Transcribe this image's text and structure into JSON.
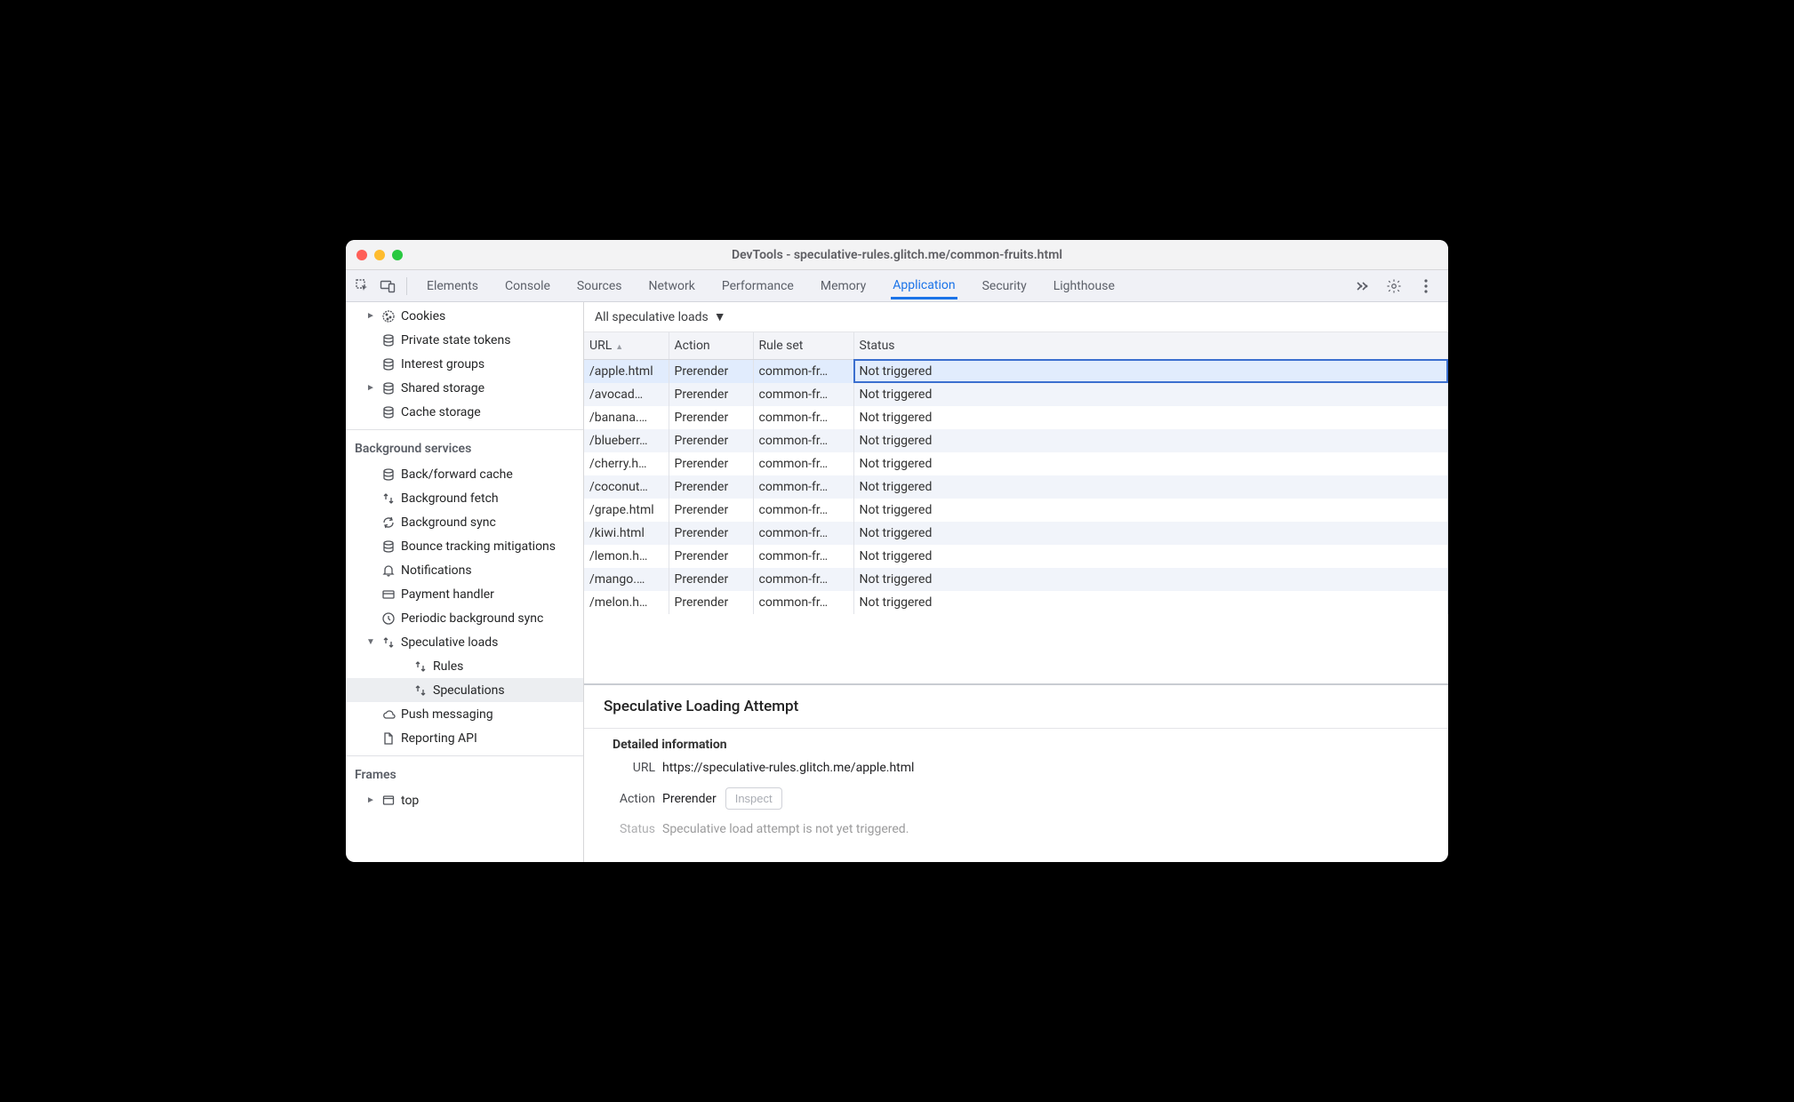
{
  "window": {
    "title": "DevTools - speculative-rules.glitch.me/common-fruits.html"
  },
  "tabs": [
    {
      "label": "Elements",
      "active": false
    },
    {
      "label": "Console",
      "active": false
    },
    {
      "label": "Sources",
      "active": false
    },
    {
      "label": "Network",
      "active": false
    },
    {
      "label": "Performance",
      "active": false
    },
    {
      "label": "Memory",
      "active": false
    },
    {
      "label": "Application",
      "active": true
    },
    {
      "label": "Security",
      "active": false
    },
    {
      "label": "Lighthouse",
      "active": false
    }
  ],
  "sidebar": {
    "storage_items": [
      {
        "label": "Cookies",
        "icon": "cookie",
        "twisty": "►",
        "indent": 1
      },
      {
        "label": "Private state tokens",
        "icon": "database",
        "twisty": "",
        "indent": 1
      },
      {
        "label": "Interest groups",
        "icon": "database",
        "twisty": "",
        "indent": 1
      },
      {
        "label": "Shared storage",
        "icon": "database",
        "twisty": "►",
        "indent": 1
      },
      {
        "label": "Cache storage",
        "icon": "database",
        "twisty": "",
        "indent": 1
      }
    ],
    "bg_heading": "Background services",
    "bg_items": [
      {
        "label": "Back/forward cache",
        "icon": "database",
        "indent": 1
      },
      {
        "label": "Background fetch",
        "icon": "updown",
        "indent": 1
      },
      {
        "label": "Background sync",
        "icon": "sync",
        "indent": 1
      },
      {
        "label": "Bounce tracking mitigations",
        "icon": "database",
        "indent": 1
      },
      {
        "label": "Notifications",
        "icon": "bell",
        "indent": 1
      },
      {
        "label": "Payment handler",
        "icon": "card",
        "indent": 1
      },
      {
        "label": "Periodic background sync",
        "icon": "clock",
        "indent": 1
      },
      {
        "label": "Speculative loads",
        "icon": "updown",
        "indent": 1,
        "twisty": "▼"
      },
      {
        "label": "Rules",
        "icon": "updown",
        "indent": 3
      },
      {
        "label": "Speculations",
        "icon": "updown",
        "indent": 3,
        "selected": true
      },
      {
        "label": "Push messaging",
        "icon": "cloud",
        "indent": 1
      },
      {
        "label": "Reporting API",
        "icon": "document",
        "indent": 1
      }
    ],
    "frames_heading": "Frames",
    "frames_items": [
      {
        "label": "top",
        "icon": "frame",
        "indent": 1,
        "twisty": "►"
      }
    ]
  },
  "filter": {
    "label": "All speculative loads"
  },
  "table": {
    "columns": [
      {
        "label": "URL",
        "sort": "asc"
      },
      {
        "label": "Action"
      },
      {
        "label": "Rule set"
      },
      {
        "label": "Status"
      }
    ],
    "rows": [
      {
        "url": "/apple.html",
        "action": "Prerender",
        "ruleset": "common-fr…",
        "status": "Not triggered",
        "selected": true
      },
      {
        "url": "/avocad…",
        "action": "Prerender",
        "ruleset": "common-fr…",
        "status": "Not triggered"
      },
      {
        "url": "/banana.…",
        "action": "Prerender",
        "ruleset": "common-fr…",
        "status": "Not triggered"
      },
      {
        "url": "/blueberr…",
        "action": "Prerender",
        "ruleset": "common-fr…",
        "status": "Not triggered"
      },
      {
        "url": "/cherry.h…",
        "action": "Prerender",
        "ruleset": "common-fr…",
        "status": "Not triggered"
      },
      {
        "url": "/coconut…",
        "action": "Prerender",
        "ruleset": "common-fr…",
        "status": "Not triggered"
      },
      {
        "url": "/grape.html",
        "action": "Prerender",
        "ruleset": "common-fr…",
        "status": "Not triggered"
      },
      {
        "url": "/kiwi.html",
        "action": "Prerender",
        "ruleset": "common-fr…",
        "status": "Not triggered"
      },
      {
        "url": "/lemon.h…",
        "action": "Prerender",
        "ruleset": "common-fr…",
        "status": "Not triggered"
      },
      {
        "url": "/mango.…",
        "action": "Prerender",
        "ruleset": "common-fr…",
        "status": "Not triggered"
      },
      {
        "url": "/melon.h…",
        "action": "Prerender",
        "ruleset": "common-fr…",
        "status": "Not triggered"
      }
    ]
  },
  "detail": {
    "title": "Speculative Loading Attempt",
    "subtitle": "Detailed information",
    "url_k": "URL",
    "url_v": "https://speculative-rules.glitch.me/apple.html",
    "action_k": "Action",
    "action_v": "Prerender",
    "inspect": "Inspect",
    "status_k": "Status",
    "status_v": "Speculative load attempt is not yet triggered."
  }
}
